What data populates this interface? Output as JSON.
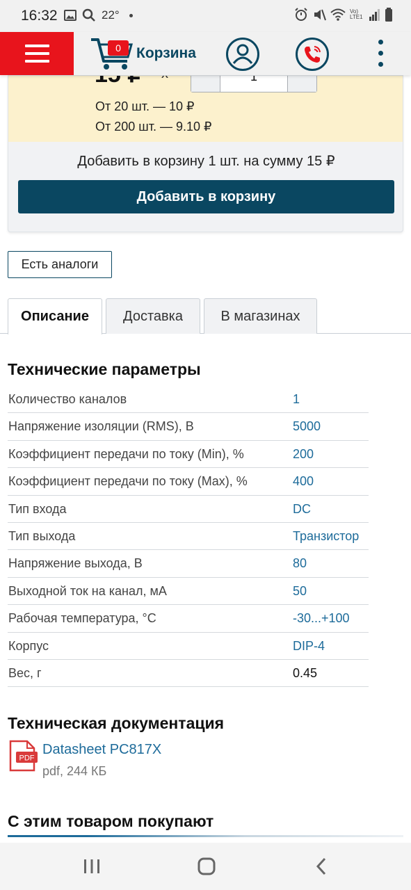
{
  "status_bar": {
    "time": "16:32",
    "temperature": "22°",
    "network": "Vo) LTE1"
  },
  "header": {
    "cart_count": "0",
    "cart_label": "Корзина",
    "icons": [
      "menu-icon",
      "cart-icon",
      "user-icon",
      "phone-icon",
      "more-vertical-icon"
    ],
    "accent_color": "#e8141c",
    "brand_color": "#0a4761"
  },
  "price_card": {
    "price": "15 ₽",
    "multiply": "x",
    "quantity": "1",
    "tiers": [
      "От 20 шт. — 10 ₽",
      "От 200 шт. — 9.10 ₽"
    ],
    "summary": "Добавить в корзину 1 шт. на сумму 15 ₽",
    "add_button": "Добавить в корзину"
  },
  "analogues_button": "Есть аналоги",
  "tabs": [
    {
      "label": "Описание",
      "active": true
    },
    {
      "label": "Доставка",
      "active": false
    },
    {
      "label": "В магазинах",
      "active": false
    }
  ],
  "tech_params": {
    "title": "Технические параметры",
    "rows": [
      {
        "name": "Количество каналов",
        "value": "1"
      },
      {
        "name": "Напряжение изоляции (RMS), В",
        "value": "5000"
      },
      {
        "name": "Коэффициент передачи по току (Min), %",
        "value": "200"
      },
      {
        "name": "Коэффициент передачи по току (Max), %",
        "value": "400"
      },
      {
        "name": "Тип входа",
        "value": "DC"
      },
      {
        "name": "Тип выхода",
        "value": "Транзистор"
      },
      {
        "name": "Напряжение выхода, В",
        "value": "80"
      },
      {
        "name": "Выходной ток на канал, мА",
        "value": "50"
      },
      {
        "name": "Рабочая температура, °С",
        "value": "-30...+100"
      },
      {
        "name": "Корпус",
        "value": "DIP-4"
      },
      {
        "name": "Вес, г",
        "value": "0.45"
      }
    ]
  },
  "tech_docs": {
    "title": "Техническая документация",
    "pdf_icon_label": "PDF",
    "doc_link": "Datasheet PC817X",
    "doc_meta": "pdf, 244 КБ"
  },
  "also_bought": {
    "title": "С этим товаром покупают"
  },
  "nav_bar": {
    "icons": [
      "recents-icon",
      "home-icon",
      "back-icon"
    ]
  }
}
